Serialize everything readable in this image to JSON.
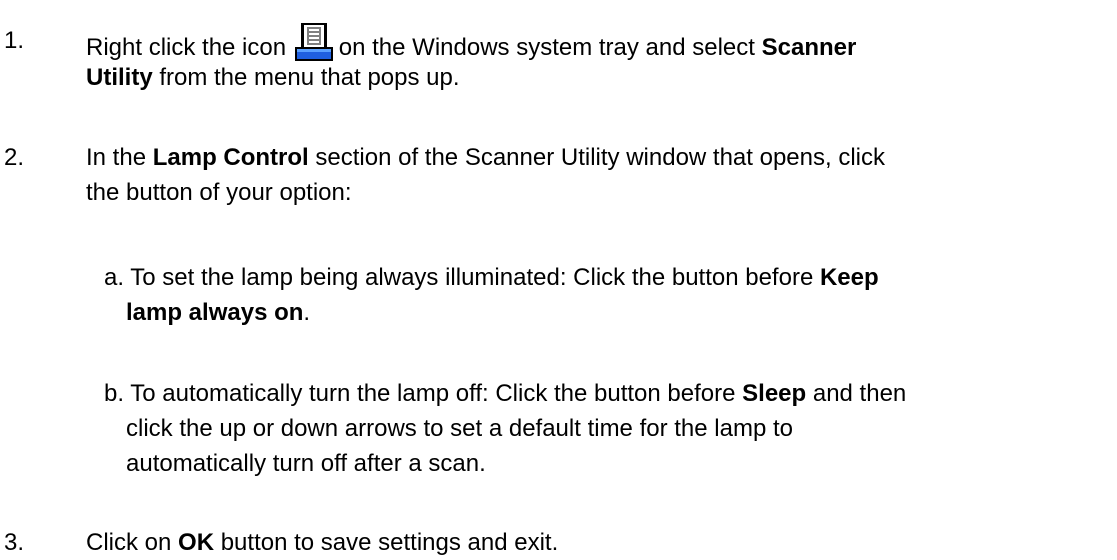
{
  "steps": [
    {
      "number": "1.",
      "line1_a": "Right click the icon",
      "icon": "scanner-tray-icon",
      "line1_b": "on the Windows system tray and select",
      "line1_bold": "Scanner",
      "line2_bold": "Utility",
      "line2_rest": "from the menu that pops up."
    },
    {
      "number": "2.",
      "line1_a": "In the",
      "line1_bold": "Lamp Control",
      "line1_b": "section of the Scanner Utility window that opens, click",
      "line2": "the button of your option:",
      "options": [
        {
          "label": "a.",
          "text": "To set the lamp being always illuminated:  Click the button before",
          "bold1": "Keep",
          "bold2": "lamp always on",
          "end": "."
        },
        {
          "label": "b.",
          "text": "To automatically turn the lamp off:  Click the button before",
          "bold": "Sleep",
          "after": "and then",
          "line2": "click the up or down arrows to set a default time for the lamp to",
          "line3": "automatically turn off after a scan."
        }
      ]
    },
    {
      "number": "3.",
      "pre": "Click on",
      "bold": "OK",
      "post": "button to save settings and exit."
    }
  ]
}
